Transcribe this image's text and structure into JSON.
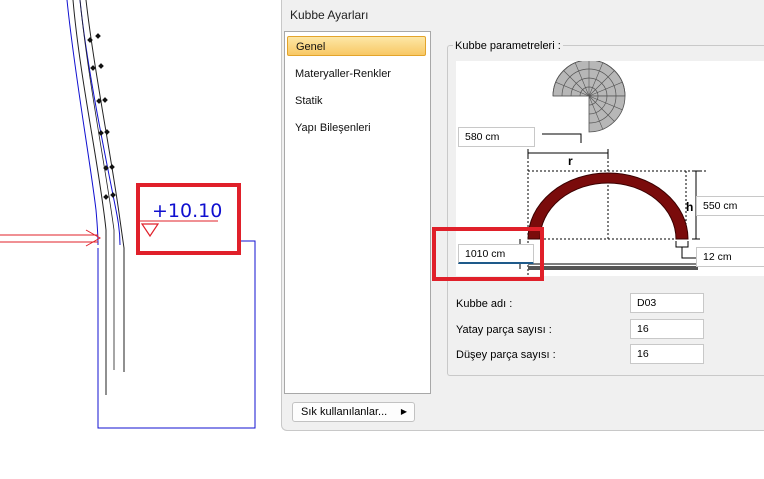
{
  "cad": {
    "elevation_label": "+10.10",
    "line_color": "#1010d0",
    "arrow_color": "#e0202a"
  },
  "highlight_color": "#e0202a",
  "dialog": {
    "title": "Kubbe Ayarları",
    "nav_items": [
      {
        "label": "Genel",
        "active": true
      },
      {
        "label": "Materyaller-Renkler",
        "active": false
      },
      {
        "label": "Statik",
        "active": false
      },
      {
        "label": "Yapı Bileşenleri",
        "active": false
      }
    ],
    "group_title": "Kubbe parametreleri :",
    "diagram": {
      "radius_value": "580 cm",
      "radius_symbol": "r",
      "height_symbol": "h",
      "height_value": "550 cm",
      "thickness_value": "12 cm",
      "diameter_value": "1010 cm",
      "dome_color": "#7a0b0b"
    },
    "fields": [
      {
        "label": "Kubbe adı :",
        "value": "D03"
      },
      {
        "label": "Yatay parça sayısı :",
        "value": "16"
      },
      {
        "label": "Düşey parça sayısı :",
        "value": "16"
      }
    ],
    "footer_button": "Sık kullanılanlar...",
    "footer_arrow": "▶"
  }
}
